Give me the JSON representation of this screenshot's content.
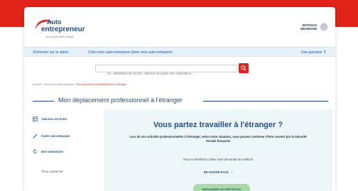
{
  "brand": {
    "line1": "Auto",
    "line2": "entrepreneur",
    "tagline": "Un service des Urssaf",
    "accent_color": "#e2231a",
    "primary_color": "#1d4f91"
  },
  "user": {
    "first_name": "MATHIAS",
    "last_name": "NEUMANN"
  },
  "nav": {
    "items": [
      {
        "label": "S'informer sur le statut"
      },
      {
        "label": "Créer mon auto-entreprise"
      },
      {
        "label": "Gérer mon auto-entreprise"
      }
    ],
    "question_label": "Une question"
  },
  "search": {
    "placeholder": "ex : Identifiant de l'Acoss, déclarer et payer mes cotisations..."
  },
  "breadcrumb": {
    "items": [
      "Accueil",
      "Gérer mon auto-entreprise"
    ],
    "current": "Mon déplacement professionnel à l'étranger"
  },
  "page_title": "Mon déplacement professionnel à l'étranger",
  "sidebar": {
    "items": [
      {
        "label": "TABLEAU DE BORD",
        "icon": "dashboard-icon"
      },
      {
        "label": "FAIRE UNE DEMANDE",
        "icon": "pencil-icon"
      },
      {
        "label": "MES DEMANDES",
        "icon": "refresh-icon"
      }
    ],
    "logout_label": "Vous connecter"
  },
  "main": {
    "title": "Vous partez travailler à l'étranger ?",
    "paragraph1": "Lors de vos activités professionnelles à l'étranger, selon votre situation, vous pouvez continuer d'être couvert par la Sécurité Sociale française",
    "paragraph2": "Pour en bénéficier, faites votre demande de certificat",
    "more_link": "EN SAVOIR PLUS",
    "cta_label": "DEMANDER UN CERTIFICAT"
  }
}
